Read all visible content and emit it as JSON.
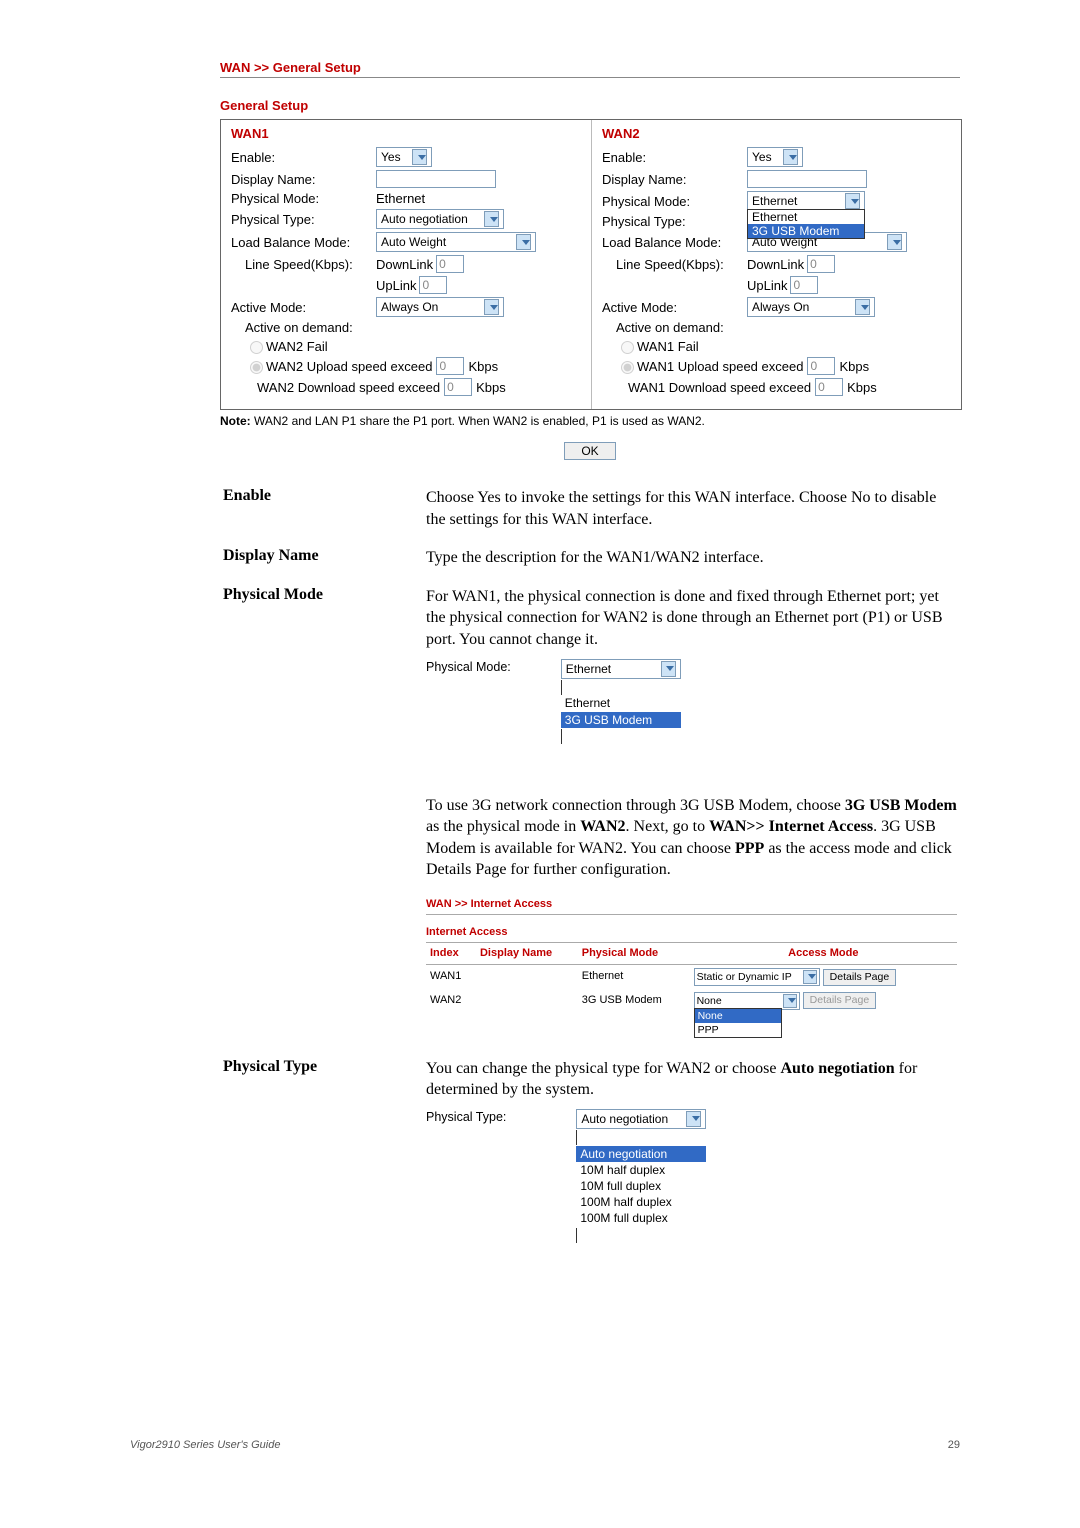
{
  "breadcrumb": "WAN >> General Setup",
  "section_title": "General Setup",
  "wan1": {
    "head": "WAN1",
    "enable_lbl": "Enable:",
    "enable_val": "Yes",
    "display_name_lbl": "Display Name:",
    "display_name_val": "",
    "phys_mode_lbl": "Physical Mode:",
    "phys_mode_val": "Ethernet",
    "phys_type_lbl": "Physical Type:",
    "phys_type_val": "Auto negotiation",
    "lbm_lbl": "Load Balance Mode:",
    "lbm_val": "Auto Weight",
    "ls_lbl": "Line Speed(Kbps):",
    "dl_lbl": "DownLink",
    "dl_val": "0",
    "ul_lbl": "UpLink",
    "ul_val": "0",
    "active_lbl": "Active Mode:",
    "active_val": "Always On",
    "aod_lbl": "Active on demand:",
    "fail_lbl": "WAN2 Fail",
    "up_exceed_lbl": "WAN2 Upload speed exceed",
    "up_exceed_val": "0",
    "dn_exceed_lbl": "WAN2 Download speed exceed",
    "dn_exceed_val": "0",
    "kbps": "Kbps"
  },
  "wan2": {
    "head": "WAN2",
    "enable_lbl": "Enable:",
    "enable_val": "Yes",
    "display_name_lbl": "Display Name:",
    "display_name_val": "",
    "phys_mode_lbl": "Physical Mode:",
    "phys_mode_top": "Ethernet",
    "phys_mode_opts": [
      "Ethernet",
      "3G USB Modem"
    ],
    "phys_type_lbl": "Physical Type:",
    "lbm_lbl": "Load Balance Mode:",
    "lbm_val": "Auto Weight",
    "ls_lbl": "Line Speed(Kbps):",
    "dl_lbl": "DownLink",
    "dl_val": "0",
    "ul_lbl": "UpLink",
    "ul_val": "0",
    "active_lbl": "Active Mode:",
    "active_val": "Always On",
    "aod_lbl": "Active on demand:",
    "fail_lbl": "WAN1 Fail",
    "up_exceed_lbl": "WAN1 Upload speed exceed",
    "up_exceed_val": "0",
    "dn_exceed_lbl": "WAN1 Download speed exceed",
    "dn_exceed_val": "0",
    "kbps": "Kbps"
  },
  "note_label": "Note:",
  "note_text": " WAN2 and LAN P1 share the P1 port. When WAN2 is enabled, P1 is used as WAN2.",
  "ok": "OK",
  "defs": {
    "enable_term": "Enable",
    "enable_desc": "Choose Yes to invoke the settings for this WAN interface. Choose No to disable the settings for this WAN interface.",
    "dname_term": "Display Name",
    "dname_desc": "Type the description for the WAN1/WAN2 interface.",
    "pmode_term": "Physical Mode",
    "pmode_desc": "For WAN1, the physical connection is done and fixed through Ethernet port; yet the physical connection for WAN2 is done through an Ethernet port (P1) or USB port. You cannot change it.",
    "pmode_shot_lbl": "Physical Mode:",
    "pmode_shot_top": "Ethernet",
    "pmode_shot_opts": [
      "Ethernet",
      "3G USB Modem"
    ],
    "pmode_extra_1": "To use 3G network connection through 3G USB Modem, choose ",
    "pmode_extra_b1": "3G USB Modem",
    "pmode_extra_2": " as the physical mode in ",
    "pmode_extra_b2": "WAN2",
    "pmode_extra_3": ". Next, go to ",
    "pmode_extra_b3": "WAN>> Internet Access",
    "pmode_extra_4": ". 3G USB Modem is available for WAN2. You can choose ",
    "pmode_extra_b4": "PPP",
    "pmode_extra_5": " as the access mode and click Details Page for further configuration.",
    "ptype_term": "Physical Type",
    "ptype_desc_1": "You can change the physical type for WAN2 or choose ",
    "ptype_desc_b1": "Auto negotiation",
    "ptype_desc_2": " for determined by the system.",
    "ptype_shot_lbl": "Physical Type:",
    "ptype_shot_top": "Auto negotiation",
    "ptype_shot_opts": [
      "Auto negotiation",
      "10M half duplex",
      "10M full duplex",
      "100M half duplex",
      "100M full duplex"
    ]
  },
  "ia": {
    "crumb": "WAN >> Internet Access",
    "sect": "Internet Access",
    "cols": [
      "Index",
      "Display Name",
      "Physical Mode",
      "Access Mode"
    ],
    "rows": [
      {
        "idx": "WAN1",
        "dn": "",
        "pm": "Ethernet",
        "am_top": "Static or Dynamic IP",
        "btn": "Details Page",
        "enabled": true
      },
      {
        "idx": "WAN2",
        "dn": "",
        "pm": "3G USB Modem",
        "am_top": "None",
        "am_opts": [
          "None",
          "PPP"
        ],
        "btn": "Details Page",
        "enabled": false
      }
    ]
  },
  "footer_left": "Vigor2910 Series User's Guide",
  "footer_right": "29"
}
